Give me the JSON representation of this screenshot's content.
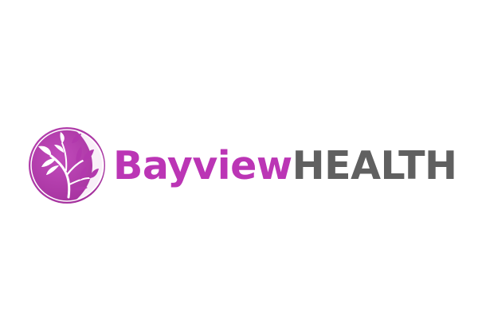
{
  "brand": {
    "name_part1": "Bayview",
    "name_part2": "HEALTH",
    "emblem_icon": "tree-leaves-circle-icon",
    "colors": {
      "accent": "#bb35b5",
      "secondary": "#606060",
      "background": "#ffffff"
    }
  }
}
